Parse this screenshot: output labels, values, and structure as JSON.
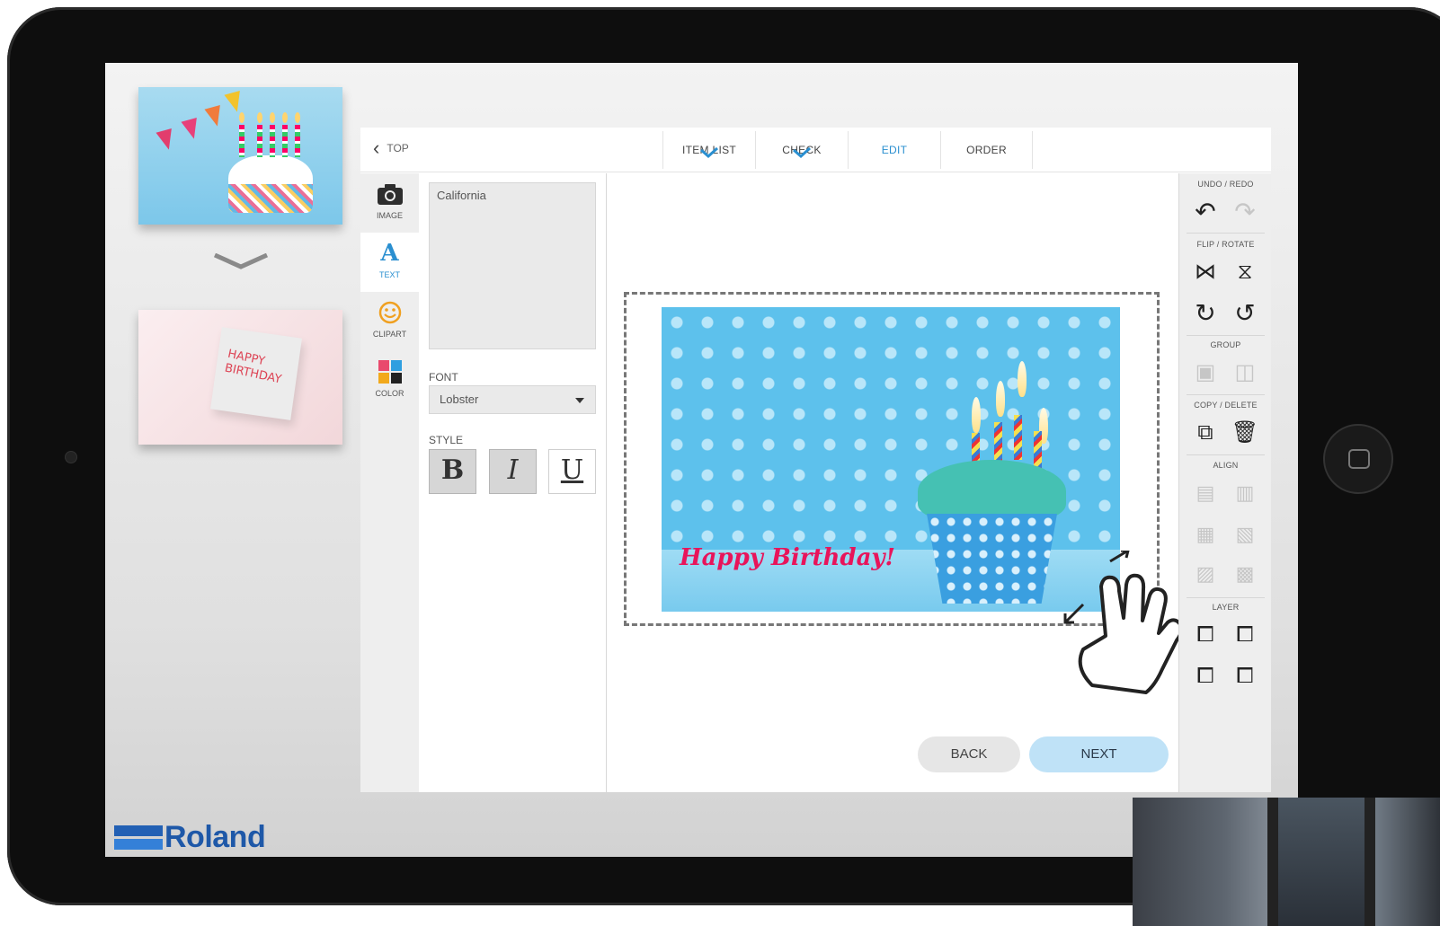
{
  "side": {
    "thumb1_alt": "",
    "thumb2_text": "HAPPY BIRTHDAY",
    "logo_text": "Roland"
  },
  "header": {
    "back_label": "TOP",
    "steps": [
      {
        "label": "ITEM LIST",
        "done": true
      },
      {
        "label": "CHECK",
        "done": true
      },
      {
        "label": "EDIT",
        "active": true
      },
      {
        "label": "ORDER"
      }
    ]
  },
  "tools": [
    {
      "label": "IMAGE",
      "icon": "camera-icon"
    },
    {
      "label": "TEXT",
      "icon": "text-a-icon"
    },
    {
      "label": "CLIPART",
      "icon": "smiley-icon"
    },
    {
      "label": "COLOR",
      "icon": "color-grid-icon"
    }
  ],
  "props": {
    "text_value": "California",
    "font_label": "FONT",
    "font_value": "Lobster",
    "style_label": "STYLE",
    "bold": "B",
    "italic": "I",
    "underline": "U"
  },
  "design": {
    "text": "Happy Birthday!"
  },
  "actions": {
    "back": "BACK",
    "next": "NEXT"
  },
  "right_rail": {
    "undo_redo": "UNDO / REDO",
    "flip_rotate": "FLIP / ROTATE",
    "group": "GROUP",
    "copy_delete": "COPY / DELETE",
    "align": "ALIGN",
    "layer": "LAYER"
  },
  "colors": {
    "accent": "#2a8fd0",
    "next_bg": "#bfe2f7",
    "design_text": "#e8145a",
    "brand": "#1e58a8"
  }
}
